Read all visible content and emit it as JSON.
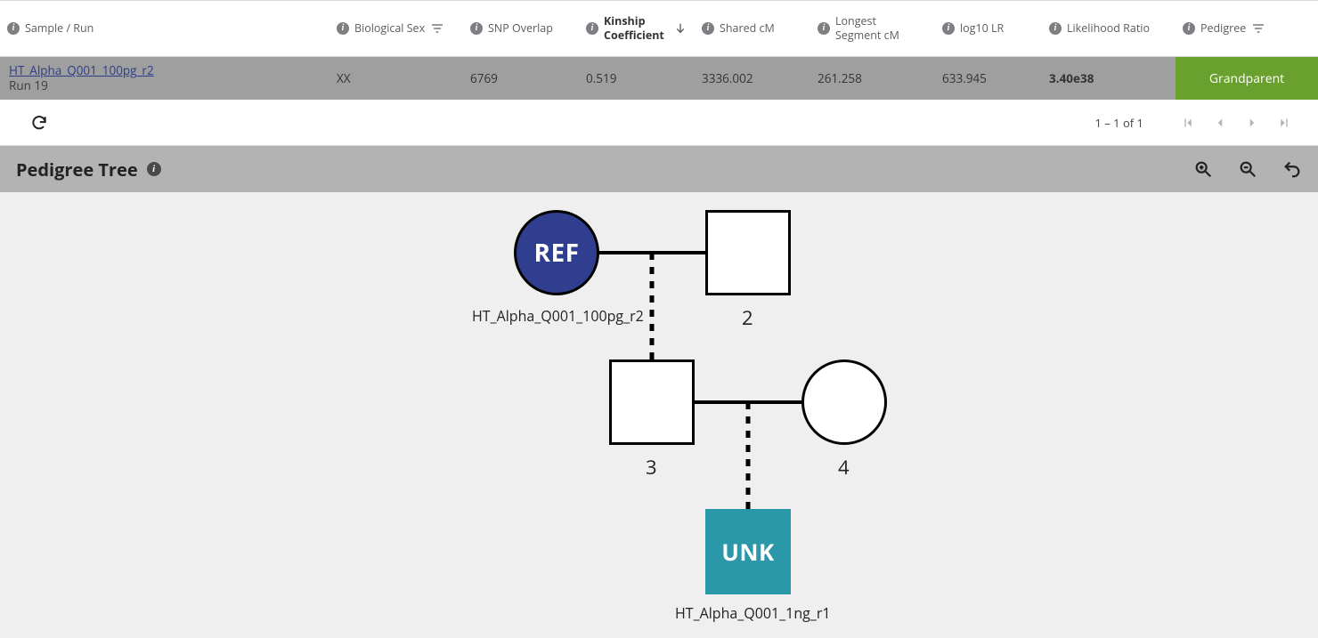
{
  "table": {
    "columns": {
      "sample": "Sample / Run",
      "sex": "Biological Sex",
      "snp": "SNP Overlap",
      "kinship": "Kinship Coefficient",
      "shared": "Shared cM",
      "longest": "Longest Segment cM",
      "log10": "log10 LR",
      "lr": "Likelihood Ratio",
      "pedigree": "Pedigree"
    },
    "row": {
      "sample_link": "HT_Alpha_Q001_100pg_r2",
      "sample_run": "Run 19",
      "sex": "XX",
      "snp": "6769",
      "kinship": "0.519",
      "shared": "3336.002",
      "longest": "261.258",
      "log10": "633.945",
      "lr": "3.40e38",
      "pedigree": "Grandparent"
    }
  },
  "pagination": {
    "range": "1 – 1 of 1"
  },
  "section": {
    "title": "Pedigree Tree"
  },
  "tree": {
    "ref_text": "REF",
    "unk_text": "UNK",
    "ref_label": "HT_Alpha_Q001_100pg_r2",
    "unk_label": "HT_Alpha_Q001_1ng_r1",
    "node2": "2",
    "node3": "3",
    "node4": "4"
  }
}
